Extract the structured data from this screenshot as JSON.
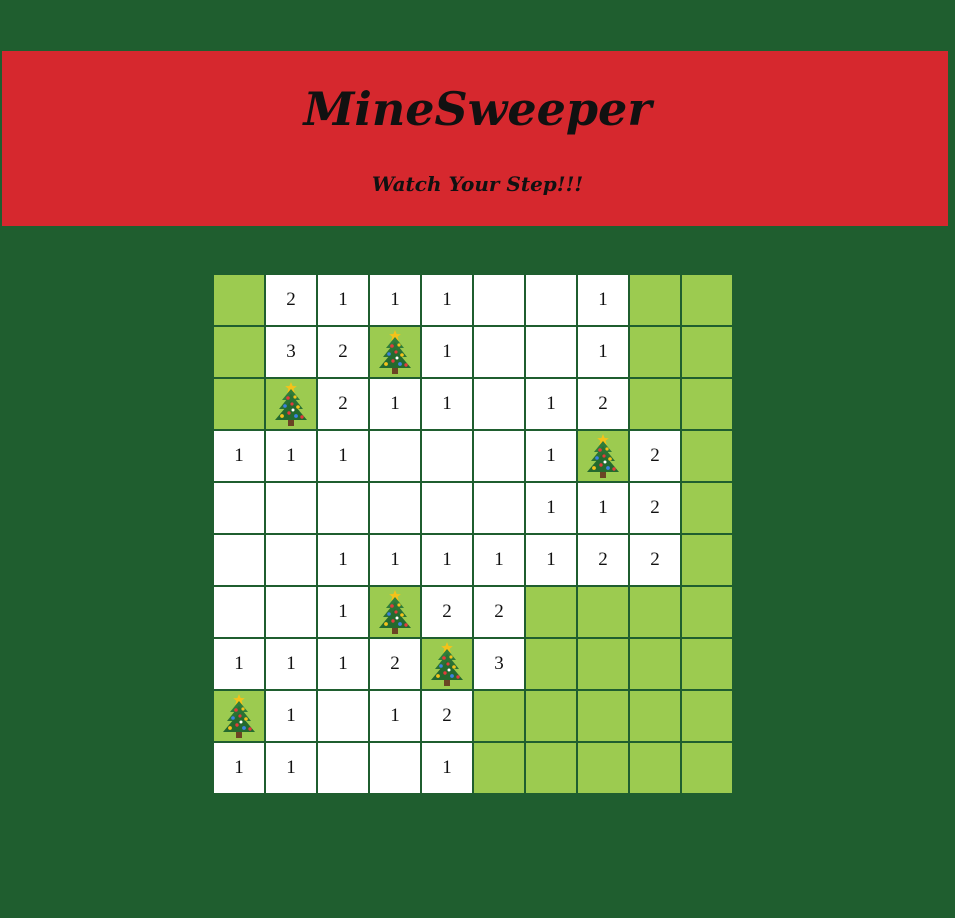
{
  "header": {
    "title": "MineSweeper",
    "subtitle": "Watch Your Step!!!"
  },
  "colors": {
    "background": "#1f5e2f",
    "header": "#d6282e",
    "hidden_cell": "#9ccb50",
    "revealed_cell": "#ffffff"
  },
  "mine_icon": "christmas-tree-icon",
  "board": {
    "rows": 10,
    "cols": 10,
    "cells": [
      [
        "H",
        "2",
        "1",
        "1",
        "1",
        "",
        "",
        "1",
        "H",
        "H"
      ],
      [
        "H",
        "3",
        "2",
        "M",
        "1",
        "",
        "",
        "1",
        "H",
        "H"
      ],
      [
        "H",
        "M",
        "2",
        "1",
        "1",
        "",
        "1",
        "2",
        "H",
        "H"
      ],
      [
        "1",
        "1",
        "1",
        "",
        "",
        "",
        "1",
        "M",
        "2",
        "H"
      ],
      [
        "",
        "",
        "",
        "",
        "",
        "",
        "1",
        "1",
        "2",
        "H"
      ],
      [
        "",
        "",
        "1",
        "1",
        "1",
        "1",
        "1",
        "2",
        "2",
        "H"
      ],
      [
        "",
        "",
        "1",
        "M",
        "2",
        "2",
        "H",
        "H",
        "H",
        "H"
      ],
      [
        "1",
        "1",
        "1",
        "2",
        "M",
        "3",
        "H",
        "H",
        "H",
        "H"
      ],
      [
        "M",
        "1",
        "",
        "1",
        "2",
        "H",
        "H",
        "H",
        "H",
        "H"
      ],
      [
        "1",
        "1",
        "",
        "",
        "1",
        "H",
        "H",
        "H",
        "H",
        "H"
      ]
    ]
  }
}
